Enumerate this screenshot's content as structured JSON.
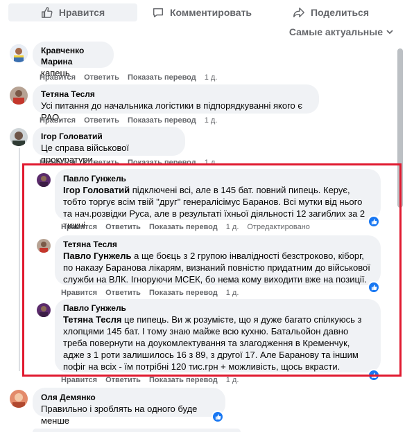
{
  "actions": {
    "like": "Нравится",
    "comment": "Комментировать",
    "share": "Поделиться"
  },
  "sort": {
    "label": "Самые актуальные"
  },
  "comments": [
    {
      "author": "Кравченко Марина",
      "text": "капець",
      "like": "Нравится",
      "reply": "Ответить",
      "translate": "Показать перевод",
      "time": "1 д."
    },
    {
      "author": "Тетяна Тесля",
      "text": "Усі питання до начальника логістики в підпорядкуванні якого є РАО.",
      "like": "Нравится",
      "reply": "Ответить",
      "translate": "Показать перевод",
      "time": "1 д."
    },
    {
      "author": "Ігор Головатий",
      "text": "Це справа військової прокуратури.",
      "like": "Нравится",
      "reply": "Ответить",
      "translate": "Показать перевод",
      "time": "1 д."
    }
  ],
  "replies": [
    {
      "author": "Павло Гунжель",
      "mention": "Ігор Головатий",
      "text": " підключені всі, але в 145 бат. повний пипець. Керує, тобто торгує всім твій \"друг\" генералісімус Баранов. Всі мутки від нього та нач.розвідки Руса, але в результаті їхньої діяльності 12 загиблих за 2 тижні.",
      "like": "Нравится",
      "reply": "Ответить",
      "translate": "Показать перевод",
      "time": "1 д.",
      "edited": "Отредактировано"
    },
    {
      "author": "Тетяна Тесля",
      "mention": "Павло Гунжель",
      "text": " а ще боєць з 2 групою інвалідності безстроково, кіборг, по наказу Баранова лікарям, визнаний повністю придатним до військової служби на ВЛК. Ігноруючи МСЕК, бо нема кому виходити вже на позиції.",
      "like": "Нравится",
      "reply": "Ответить",
      "translate": "Показать перевод",
      "time": "1 д."
    },
    {
      "author": "Павло Гунжель",
      "mention": "Тетяна Тесля",
      "text": " це пипець. Ви ж розумієте, що я дуже багато спілкуюсь з хлопцями 145 бат. І тому знаю майже всю кухню. Батальойон давно треба повернути на доукомлектування та злагодження в Кременчук, адже з 1 роти залишилось 16 з 89, з другої 17. Але Баранову та іншим пофіг на всіх - їм потрібні 120 тис.грн + можливість, щось вкрасти.",
      "like": "Нравится",
      "reply": "Ответить",
      "translate": "Показать перевод",
      "time": "1 д."
    }
  ],
  "last_comment": {
    "author": "Оля Демянко",
    "text": "Правильно і зроблять на одного буде менше"
  },
  "colors": {
    "accent": "#1877f2",
    "highlight": "#e0192f",
    "bubble": "#f0f2f5",
    "meta": "#65676b"
  }
}
